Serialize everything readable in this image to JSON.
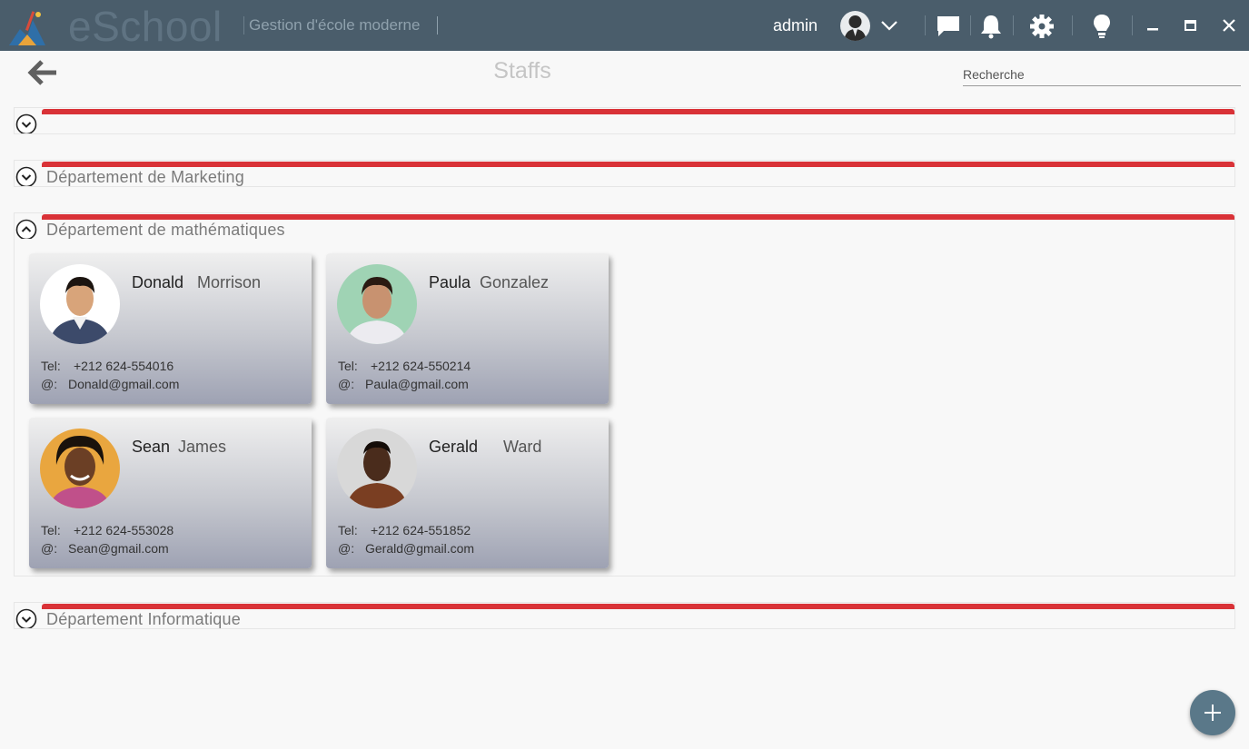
{
  "app": {
    "name": "eSchool",
    "subtitle": "Gestion d'école moderne",
    "user": "admin"
  },
  "header": {
    "title": "Staffs",
    "search_placeholder": "Recherche"
  },
  "departments": [
    {
      "name": "",
      "expanded": false
    },
    {
      "name": "Département de Marketing",
      "expanded": false
    },
    {
      "name": "Département de mathématiques",
      "expanded": true,
      "staff": [
        {
          "first": "Donald",
          "last": "Morrison",
          "tel_label": "Tel:",
          "tel": "+212 624-554016",
          "email_label": "@:",
          "email": "Donald@gmail.com"
        },
        {
          "first": "Paula",
          "last": "Gonzalez",
          "tel_label": "Tel:",
          "tel": "+212 624-550214",
          "email_label": "@:",
          "email": "Paula@gmail.com"
        },
        {
          "first": "Sean",
          "last": "James",
          "tel_label": "Tel:",
          "tel": "+212 624-553028",
          "email_label": "@:",
          "email": "Sean@gmail.com"
        },
        {
          "first": "Gerald",
          "last": "Ward",
          "tel_label": "Tel:",
          "tel": "+212 624-551852",
          "email_label": "@:",
          "email": "Gerald@gmail.com"
        }
      ]
    },
    {
      "name": "Département Informatique",
      "expanded": false
    }
  ],
  "colors": {
    "titlebar": "#4a5d6b",
    "accent_red": "#d93237",
    "fab": "#5a7889"
  },
  "icons": [
    "app-logo",
    "user-avatar",
    "chevron-down-icon",
    "chat-icon",
    "bell-icon",
    "gear-icon",
    "lightbulb-icon",
    "minimize-icon",
    "maximize-icon",
    "close-icon",
    "back-arrow-icon",
    "expand-icon",
    "collapse-icon",
    "plus-icon"
  ]
}
